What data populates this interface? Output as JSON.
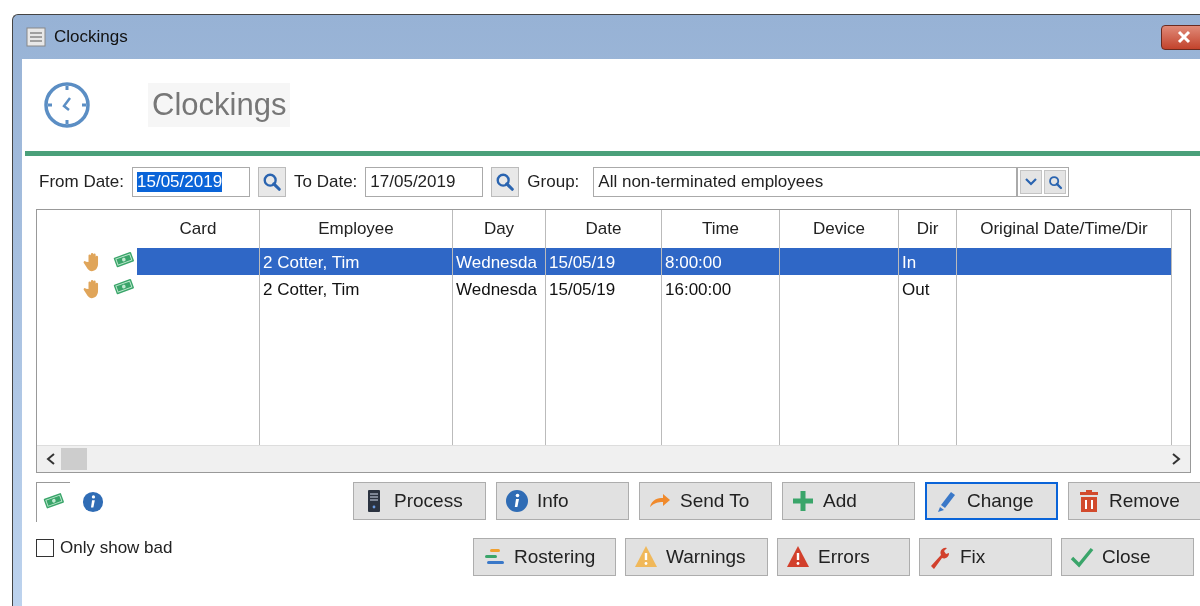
{
  "window": {
    "title": "Clockings"
  },
  "header": {
    "title": "Clockings"
  },
  "filters": {
    "from_date": {
      "label": "From Date:",
      "value": "15/05/2019",
      "selected": true
    },
    "to_date": {
      "label": "To Date:",
      "value": "17/05/2019",
      "selected": false
    },
    "group": {
      "label": "Group:",
      "value": "All non-terminated employees"
    }
  },
  "table": {
    "columns": [
      "Card",
      "Employee",
      "Day",
      "Date",
      "Time",
      "Device",
      "Dir",
      "Original Date/Time/Dir"
    ],
    "rows": [
      {
        "selected": true,
        "employee": "2 Cotter, Tim",
        "day": "Wednesda",
        "date": "15/05/19",
        "time": "8:00:00",
        "dir": "In"
      },
      {
        "selected": false,
        "employee": "2 Cotter, Tim",
        "day": "Wednesda",
        "date": "15/05/19",
        "time": "16:00:00",
        "dir": "Out"
      }
    ]
  },
  "side_tabs": [
    {
      "kind": "money",
      "selected": true
    },
    {
      "kind": "info",
      "selected": false
    }
  ],
  "only_show_bad": {
    "label": "Only show bad",
    "checked": false
  },
  "button_rows": [
    [
      {
        "label": "Process",
        "kind": "process",
        "focused": false
      },
      {
        "label": "Info",
        "kind": "info",
        "focused": false
      },
      {
        "label": "Send To",
        "kind": "send",
        "focused": false
      },
      {
        "label": "Add",
        "kind": "add",
        "focused": false
      },
      {
        "label": "Change",
        "kind": "change",
        "focused": true
      },
      {
        "label": "Remove",
        "kind": "remove",
        "focused": false
      }
    ],
    [
      {
        "label": "Rostering",
        "kind": "rostering",
        "focused": false
      },
      {
        "label": "Warnings",
        "kind": "warning",
        "focused": false
      },
      {
        "label": "Errors",
        "kind": "error",
        "focused": false
      },
      {
        "label": "Fix",
        "kind": "fix",
        "focused": false
      },
      {
        "label": "Close",
        "kind": "close",
        "focused": false
      }
    ]
  ]
}
